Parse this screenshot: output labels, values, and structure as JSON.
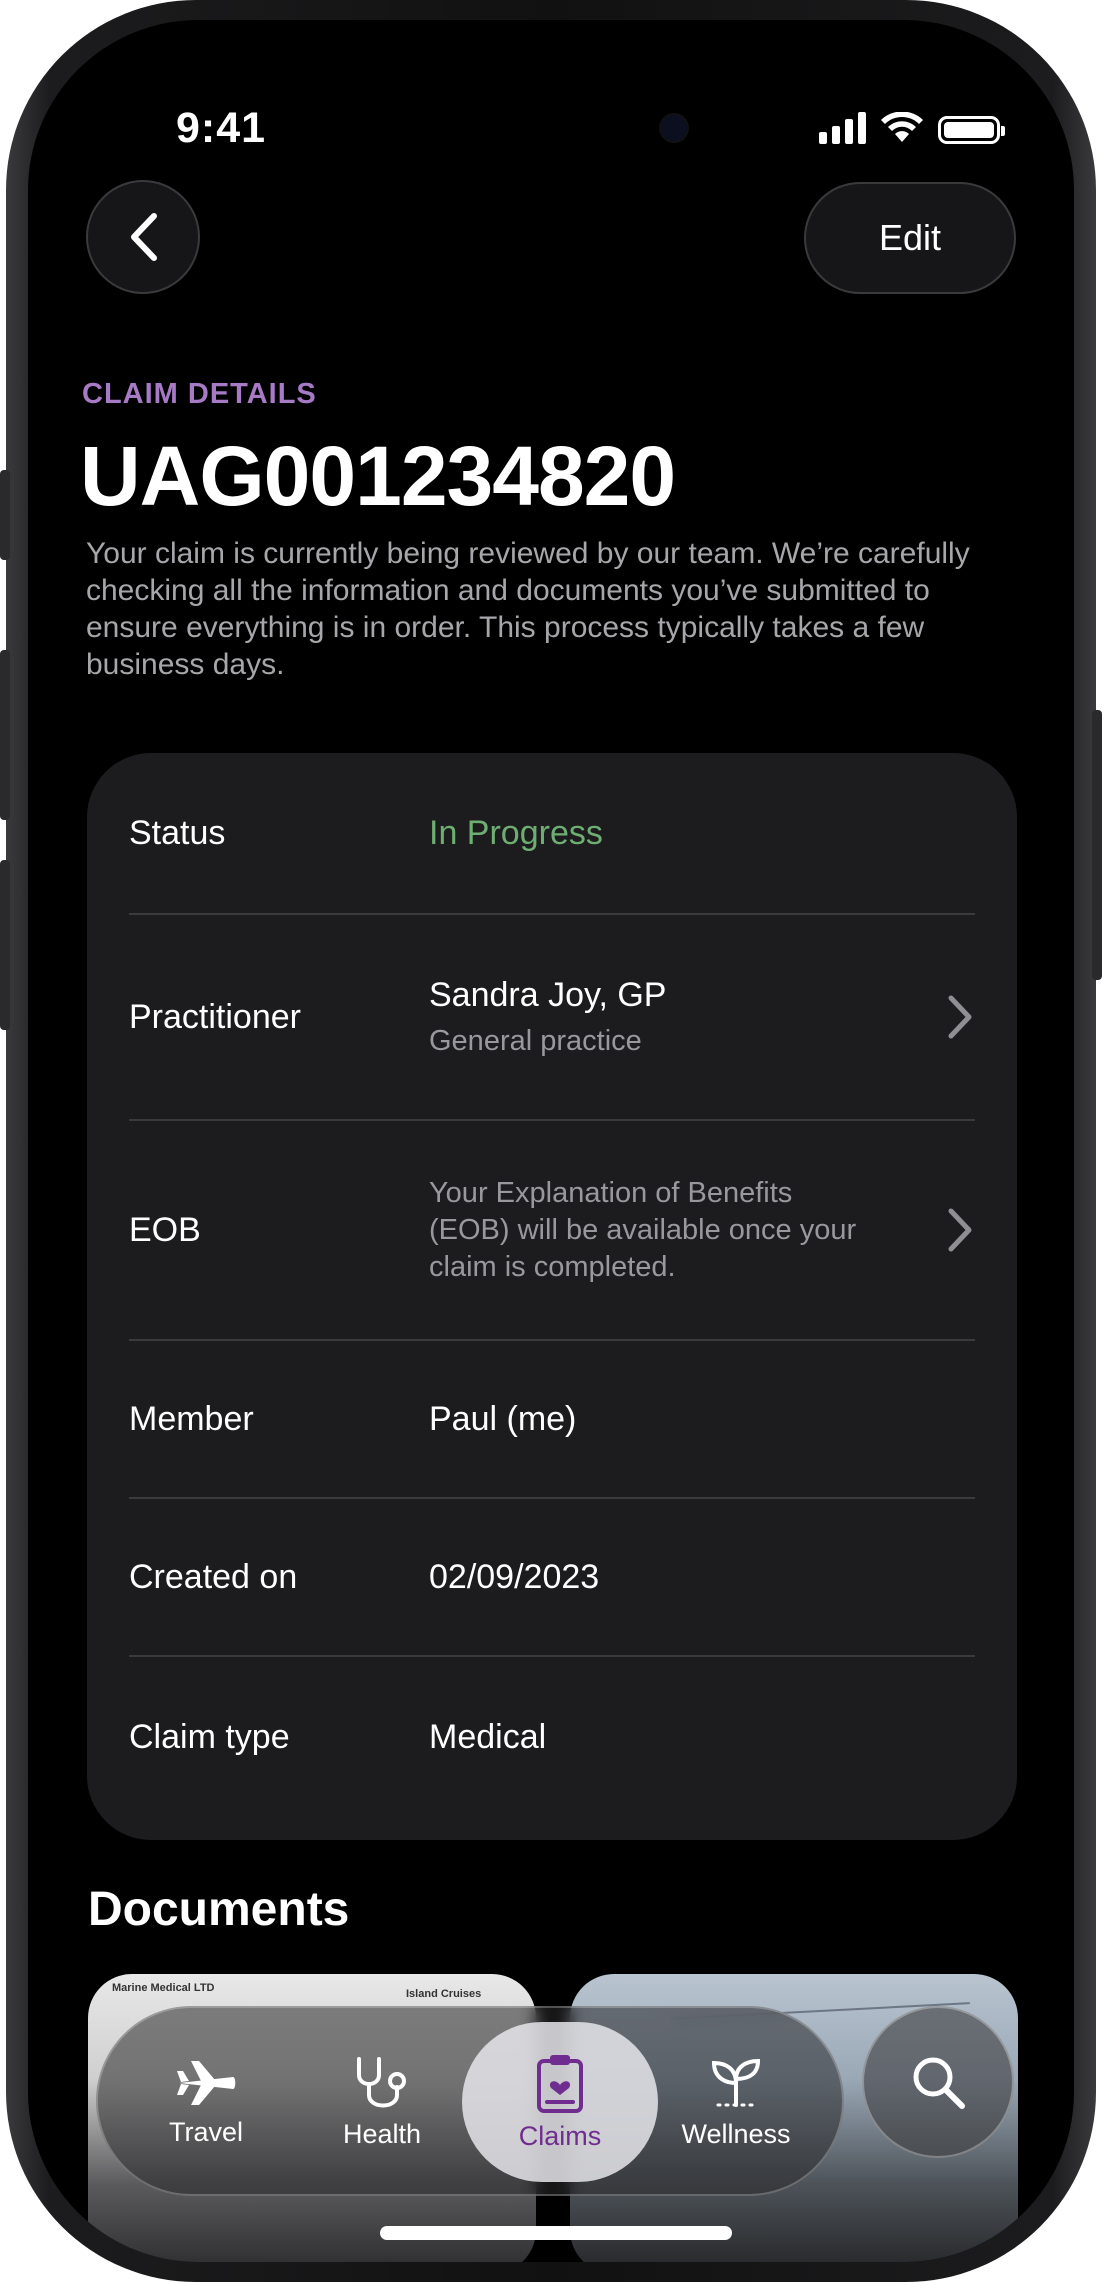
{
  "status_bar": {
    "time": "9:41"
  },
  "header": {
    "back_icon": "chevron-left-icon",
    "edit_label": "Edit"
  },
  "claim": {
    "eyebrow": "CLAIM DETAILS",
    "id": "UAG001234820",
    "description": "Your claim is currently being reviewed by our team. We’re carefully checking all the information and documents you’ve submitted to ensure everything is in order. This process typically takes a few business days."
  },
  "details": {
    "status": {
      "label": "Status",
      "value": "In Progress",
      "color": "#6fae72"
    },
    "practitioner": {
      "label": "Practitioner",
      "name": "Sandra Joy, GP",
      "specialty": "General practice"
    },
    "eob": {
      "label": "EOB",
      "text": "Your Explanation of Benefits (EOB) will be available once your claim is completed."
    },
    "member": {
      "label": "Member",
      "value": "Paul (me)"
    },
    "created_on": {
      "label": "Created on",
      "value": "02/09/2023"
    },
    "claim_type": {
      "label": "Claim type",
      "value": "Medical"
    }
  },
  "documents": {
    "title": "Documents",
    "thumb1_header_left": "Marine Medical LTD",
    "thumb1_header_right": "Island Cruises"
  },
  "tabbar": {
    "tabs": [
      {
        "label": "Travel",
        "icon": "airplane-icon"
      },
      {
        "label": "Health",
        "icon": "stethoscope-icon"
      },
      {
        "label": "Claims",
        "icon": "clipboard-icon",
        "active": true
      },
      {
        "label": "Wellness",
        "icon": "sprout-icon"
      }
    ],
    "search_icon": "search-icon",
    "accent": "#6f2d8f"
  }
}
